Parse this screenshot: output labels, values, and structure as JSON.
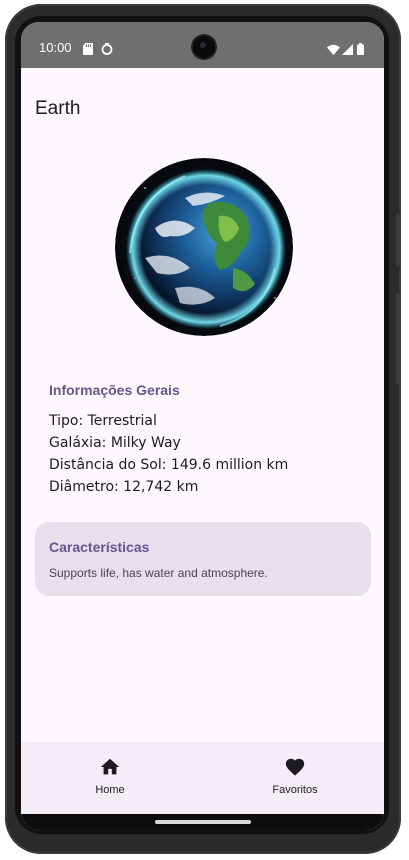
{
  "status_bar": {
    "time": "10:00",
    "left_icons": [
      "sd-card-icon",
      "sync-icon"
    ],
    "right_icons": [
      "wifi-icon",
      "signal-icon",
      "battery-icon"
    ]
  },
  "page": {
    "title": "Earth",
    "image": "earth-planet-image"
  },
  "general_info": {
    "heading": "Informações Gerais",
    "lines": [
      "Tipo: Terrestrial",
      "Galáxia: Milky Way",
      "Distância do Sol: 149.6 million km",
      "Diâmetro: 12,742 km"
    ]
  },
  "characteristics": {
    "heading": "Características",
    "text": "Supports life, has water and atmosphere."
  },
  "bottom_nav": {
    "items": [
      {
        "label": "Home",
        "icon": "home-icon"
      },
      {
        "label": "Favoritos",
        "icon": "heart-icon"
      }
    ]
  },
  "colors": {
    "background": "#fef7ff",
    "accent": "#65558f",
    "card": "#e7e0ec",
    "nav": "#f3edf7",
    "status_bar": "#6f6f6f"
  }
}
